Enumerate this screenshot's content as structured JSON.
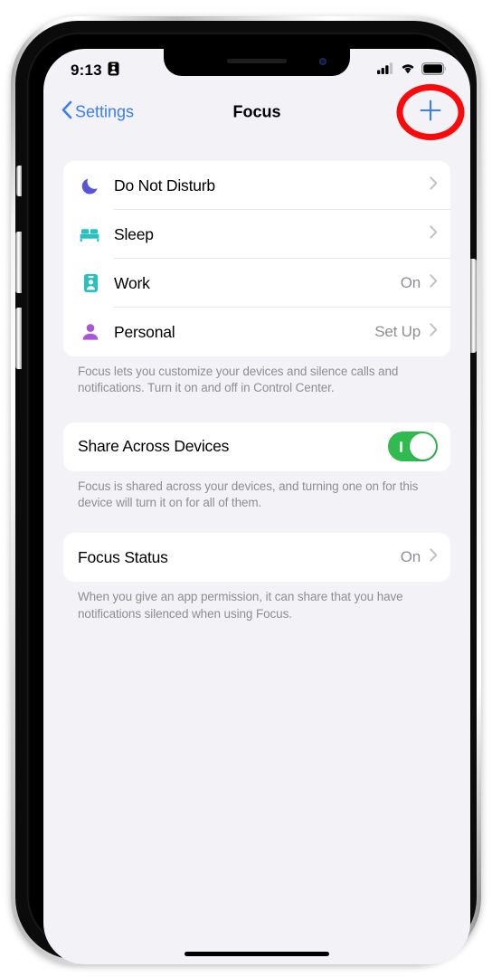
{
  "device": {
    "name": "iphone-frame"
  },
  "status_bar": {
    "time": "9:13",
    "focus_badge_icon": "id-badge-icon",
    "cellular_icon": "cellular-signal-icon",
    "cellular_bars_filled": 3,
    "cellular_bars_total": 4,
    "wifi_icon": "wifi-icon",
    "battery_icon": "battery-full-icon"
  },
  "nav": {
    "back_label": "Settings",
    "back_icon": "chevron-left-icon",
    "title": "Focus",
    "add_icon": "plus-icon",
    "add_color": "#3b7df6",
    "highlight_color": "#fa0a0a"
  },
  "focus_list": {
    "items": [
      {
        "label": "Do Not Disturb",
        "value": "",
        "icon": "moon-icon",
        "icon_color": "#5856d6"
      },
      {
        "label": "Sleep",
        "value": "",
        "icon": "bed-icon",
        "icon_color": "#2ac0c0"
      },
      {
        "label": "Work",
        "value": "On",
        "icon": "id-badge-icon",
        "icon_color": "#2ac0c0"
      },
      {
        "label": "Personal",
        "value": "Set Up",
        "icon": "person-icon",
        "icon_color": "#a855d6"
      }
    ],
    "footnote": "Focus lets you customize your devices and silence calls and notifications. Turn it on and off in Control Center."
  },
  "share_section": {
    "label": "Share Across Devices",
    "toggle_on": true,
    "toggle_color": "#2fbb4f",
    "footnote": "Focus is shared across your devices, and turning one on for this device will turn it on for all of them."
  },
  "focus_status_section": {
    "label": "Focus Status",
    "value": "On",
    "footnote": "When you give an app permission, it can share that you have notifications silenced when using Focus."
  }
}
